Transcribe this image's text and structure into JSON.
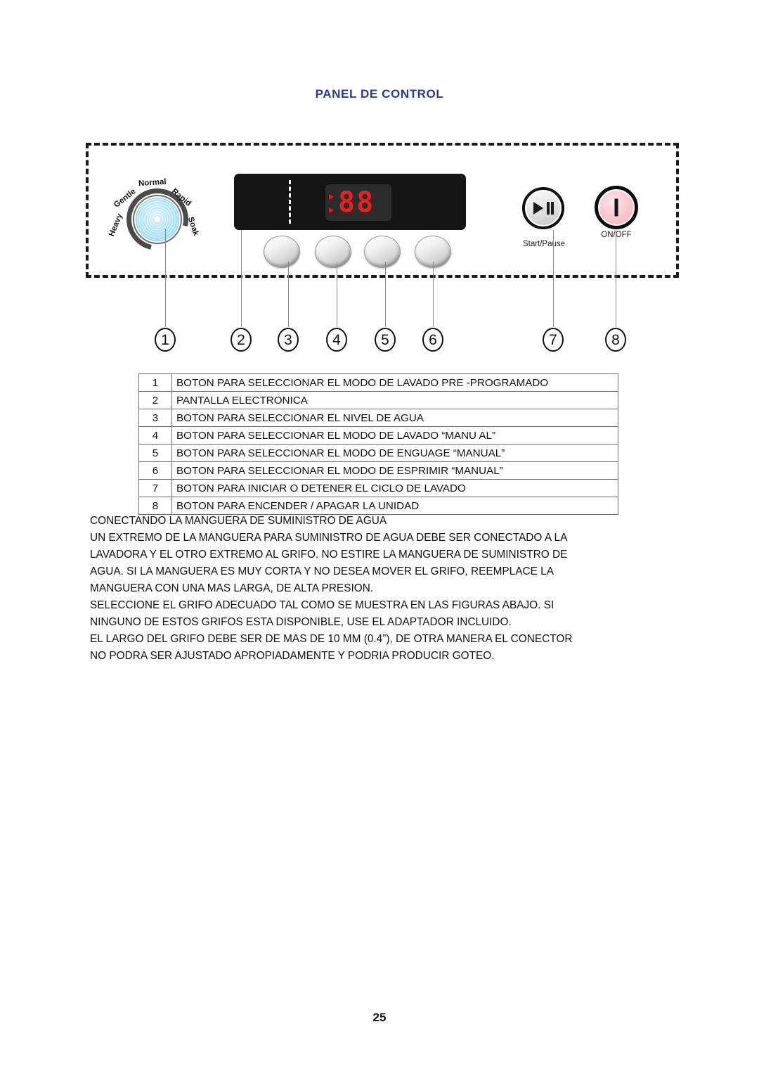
{
  "page": {
    "title": "PANEL DE CONTROL",
    "number": "25"
  },
  "control_panel": {
    "knob": {
      "name": "program-selector-knob",
      "labels": [
        "Heavy",
        "Gentle",
        "Normal",
        "Rapid",
        "Soak"
      ],
      "color": "#a9e0f5"
    },
    "display": {
      "digits": "88",
      "indicator_count": 2,
      "digit_color": "#e8201f",
      "panel_color": "#141414"
    },
    "round_buttons": [
      "",
      "",
      "",
      ""
    ],
    "start_pause": {
      "label": "Start/Pause",
      "icon": "play-pause-icon"
    },
    "on_off": {
      "label": "ON/OFF",
      "icon": "power-bar-icon",
      "color": "#f2aebb"
    },
    "callouts": [
      "1",
      "2",
      "3",
      "4",
      "5",
      "6",
      "7",
      "8"
    ]
  },
  "legend": {
    "rows": [
      {
        "num": "1",
        "desc": "BOTON PARA SELECCIONAR EL MODO DE LAVADO PRE -PROGRAMADO"
      },
      {
        "num": "2",
        "desc": "PANTALLA ELECTRONICA"
      },
      {
        "num": "3",
        "desc": "BOTON PARA SELECCIONAR EL NIVEL DE AGUA"
      },
      {
        "num": "4",
        "desc": "BOTON PARA SELECCIONAR EL MODO DE LAVADO “MANU AL”"
      },
      {
        "num": "5",
        "desc": "BOTON PARA SELECCIONAR EL MODO DE ENGUAGE “MANUAL”"
      },
      {
        "num": "6",
        "desc": "BOTON PARA SELECCIONAR EL MODO DE ESPRIMIR “MANUAL”"
      },
      {
        "num": "7",
        "desc": "BOTON PARA INICIAR O DETENER EL CICLO DE LAVADO"
      },
      {
        "num": "8",
        "desc": "BOTON PARA ENCENDER / APAGAR LA UNIDAD"
      }
    ]
  },
  "body": {
    "lines": [
      "CONECTANDO LA MANGUERA DE SUMINISTRO DE AGUA",
      "UN EXTREMO DE LA MANGUERA PARA SUMINISTRO DE AGUA DEBE SER CONECTADO A LA",
      "LAVADORA Y EL OTRO EXTREMO AL GRIFO.  NO ESTIRE LA MANGUERA DE SUMINISTRO DE",
      "AGUA.  SI LA MANGUERA ES MUY CORTA Y NO DESEA MOVER EL GRIFO, REEMPLACE LA",
      "MANGUERA CON UNA MAS LARGA, DE ALTA PRESION.",
      "SELECCIONE EL GRIFO ADECUADO TAL COMO SE MUESTRA EN LAS FIGURAS ABAJO.  SI",
      "NINGUNO DE ESTOS GRIFOS ESTA DISPONIBLE, USE EL ADAPTADOR INCLUIDO.",
      "EL LARGO DEL GRIFO DEBE SER DE MAS DE 10 MM (0.4”), DE OTRA MANERA EL CONECTOR",
      "NO PODRA SER AJUSTADO APROPIADAMENTE Y PODRIA PRODUCIR GOTEO."
    ]
  }
}
